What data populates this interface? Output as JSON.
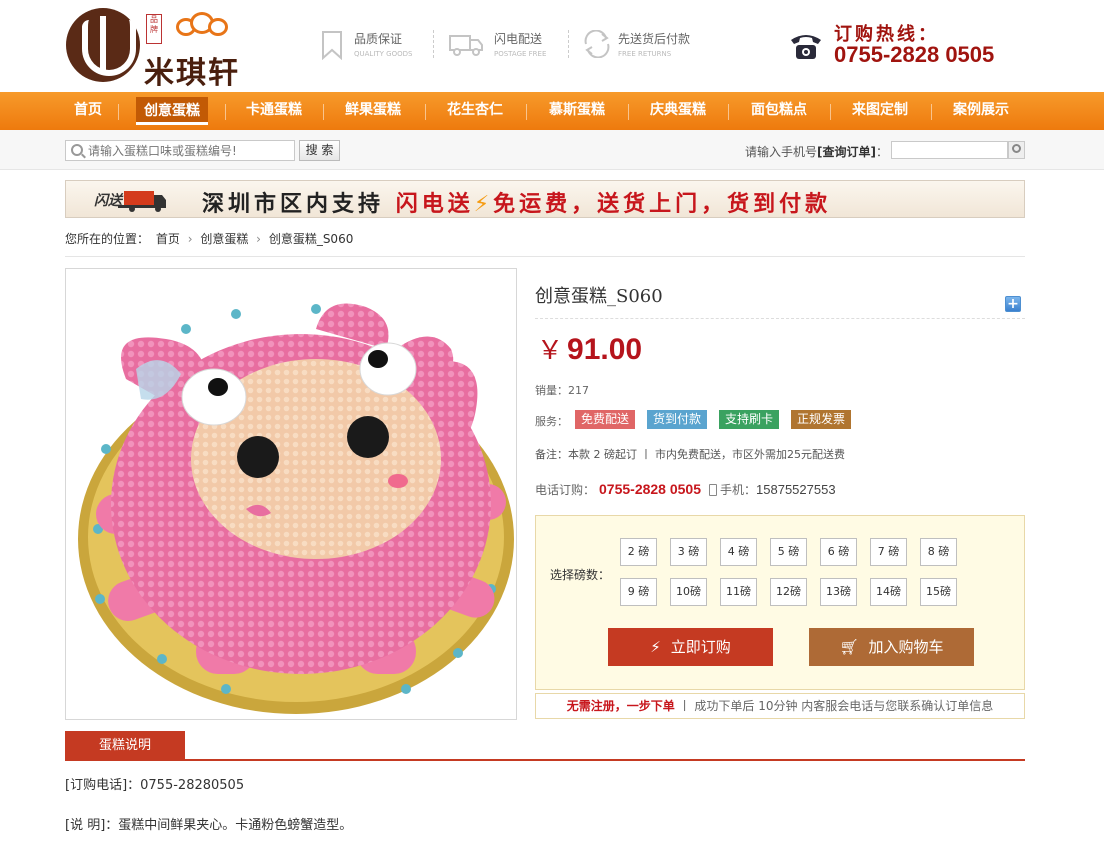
{
  "header": {
    "brand_name": "米琪轩",
    "brand_seal": "品牌",
    "promises": [
      {
        "title": "品质保证",
        "subtitle": "QUALITY GOODS",
        "icon": "bookmark-icon"
      },
      {
        "title": "闪电配送",
        "subtitle": "POSTAGE FREE",
        "icon": "truck-icon"
      },
      {
        "title": "先送货后付款",
        "subtitle": "FREE RETURNS",
        "icon": "return-icon"
      }
    ],
    "hotline_label": "订购热线：",
    "hotline_number": "0755-2828 0505"
  },
  "nav": {
    "items": [
      "首页",
      "创意蛋糕",
      "卡通蛋糕",
      "鲜果蛋糕",
      "花生杏仁",
      "慕斯蛋糕",
      "庆典蛋糕",
      "面包糕点",
      "来图定制",
      "案例展示"
    ],
    "active_index": 1
  },
  "search": {
    "placeholder": "请输入蛋糕口味或蛋糕编号!",
    "button": "搜 索",
    "order_query_prefix": "请输入手机号",
    "order_query_bold": "[查询订单]",
    "order_query_suffix": "："
  },
  "banner": {
    "badge": "闪送",
    "text_prefix": "深圳市区内支持",
    "text_highlight": "闪电送",
    "text_suffix": "免运费，送货上门，货到付款"
  },
  "breadcrumb": {
    "prefix": "您所在的位置：",
    "items": [
      "首页",
      "创意蛋糕",
      "创意蛋糕_S060"
    ],
    "separator": "›"
  },
  "product": {
    "title": "创意蛋糕_S060",
    "currency": "￥",
    "price": "91.00",
    "sales_label": "销量：",
    "sales": "217",
    "service_label": "服务：",
    "services": [
      {
        "label": "免费配送",
        "color": "#e06666"
      },
      {
        "label": "货到付款",
        "color": "#5aa4cf"
      },
      {
        "label": "支持刷卡",
        "color": "#3aa260"
      },
      {
        "label": "正规发票",
        "color": "#b07530"
      }
    ],
    "note": "备注：本款 2 磅起订 丨 市内免费配送，市区外需加25元配送费",
    "phone_label": "电话订购：",
    "phone": "0755-2828 0505",
    "mobile_label": "手机：",
    "mobile": "15875527553",
    "weight_label": "选择磅数：",
    "weights": [
      "2 磅",
      "3 磅",
      "4 磅",
      "5 磅",
      "6 磅",
      "7 磅",
      "8 磅",
      "9 磅",
      "10磅",
      "11磅",
      "12磅",
      "13磅",
      "14磅",
      "15磅"
    ],
    "buy_button": "立即订购",
    "cart_button": "加入购物车",
    "tip_highlight": "无需注册，一步下单",
    "tip_rest": "丨 成功下单后 10分钟 内客服会电话与您联系确认订单信息"
  },
  "tabs": {
    "active": "蛋糕说明"
  },
  "description": {
    "line1": "[订购电话]：0755-28280505",
    "line2": "[说 明]：蛋糕中间鲜果夹心。卡通粉色螃蟹造型。"
  }
}
